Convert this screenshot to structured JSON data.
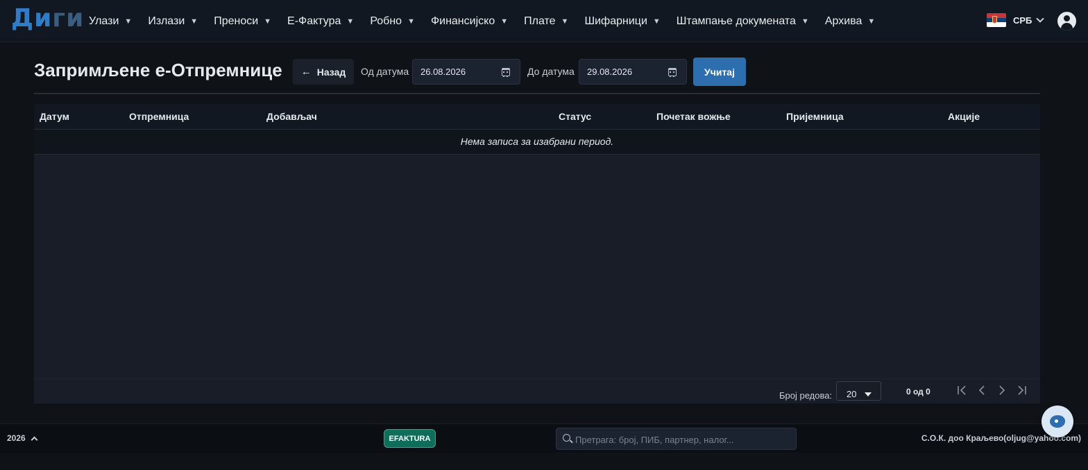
{
  "app": {
    "logo_part1": "Ди",
    "logo_part2": "ги"
  },
  "nav": {
    "items": [
      {
        "label": "Улази"
      },
      {
        "label": "Излази"
      },
      {
        "label": "Преноси"
      },
      {
        "label": "Е-Фактура"
      },
      {
        "label": "Робно"
      },
      {
        "label": "Финансијско"
      },
      {
        "label": "Плате"
      },
      {
        "label": "Шифарници"
      },
      {
        "label": "Штампање докумената"
      },
      {
        "label": "Архива"
      }
    ],
    "language": "СРБ",
    "caret": "▼"
  },
  "page": {
    "title": "Запримљене е-Отпремнице",
    "back_label": "Назад",
    "back_arrow": "←",
    "from_label": "Од датума",
    "from_value": "26.08.2026",
    "to_label": "До датума",
    "to_value": "29.08.2026",
    "load_label": "Учитај"
  },
  "table": {
    "columns": [
      "Датум",
      "Отпремница",
      "Добављач",
      "Статус",
      "Почетак вожње",
      "Пријемница",
      "Акције"
    ],
    "empty_message": "Нема записа за изабрани период.",
    "rows": []
  },
  "paginator": {
    "rows_label": "Број редова:",
    "rows_value": "20",
    "count_text": "0 од 0"
  },
  "footer": {
    "year": "2026",
    "badge": "EFAKTURA",
    "search_placeholder": "Претрага: број, ПИБ, партнер, налог...",
    "company": "С.О.К. доо Краљево(oljug@yahoo.com)"
  },
  "colors": {
    "accent": "#2d6fae",
    "badge_bg": "#0f6e5a",
    "background": "#0f1318"
  },
  "icons": [
    "calendar-icon",
    "search-icon",
    "user-icon",
    "flag-icon",
    "arrow-left-icon",
    "chat-icon"
  ]
}
